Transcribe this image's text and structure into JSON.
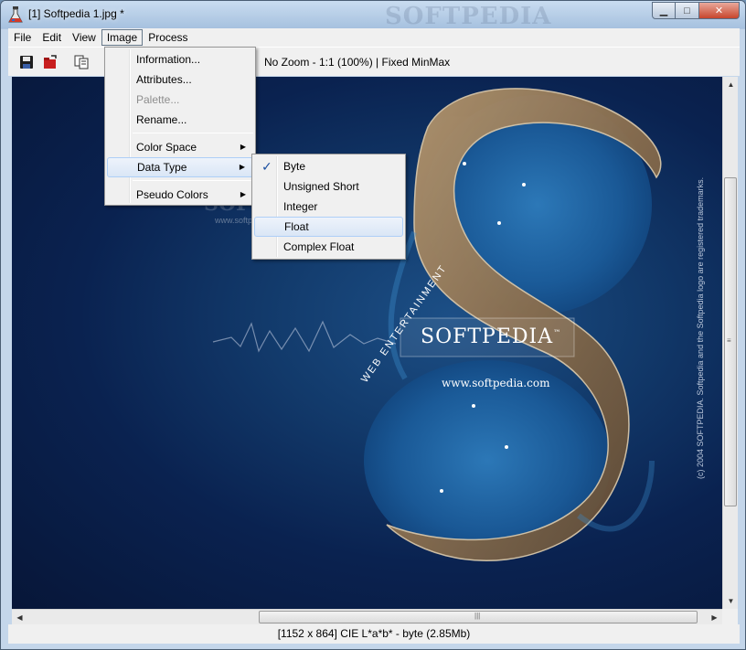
{
  "window": {
    "title": "[1] Softpedia 1.jpg *",
    "title_watermark": "SOFTPEDIA",
    "minimize": "▁",
    "maximize": "□",
    "close": "✕"
  },
  "menubar": [
    "File",
    "Edit",
    "View",
    "Image",
    "Process"
  ],
  "toolbar": {
    "icons": [
      "save-icon",
      "open-icon",
      "copy-icon"
    ],
    "zoom_info": "No Zoom - 1:1 (100%) | Fixed MinMax"
  },
  "image_menu": {
    "items": [
      {
        "label": "Information...",
        "enabled": true
      },
      {
        "label": "Attributes...",
        "enabled": true
      },
      {
        "label": "Palette...",
        "enabled": false
      },
      {
        "label": "Rename...",
        "enabled": true
      },
      {
        "label": "Color Space",
        "submenu": true
      },
      {
        "label": "Data Type",
        "submenu": true,
        "highlighted": true
      },
      {
        "label": "Pseudo Colors",
        "submenu": true
      }
    ]
  },
  "data_type_menu": {
    "items": [
      {
        "label": "Byte",
        "checked": true
      },
      {
        "label": "Unsigned Short",
        "checked": false
      },
      {
        "label": "Integer",
        "checked": false
      },
      {
        "label": "Float",
        "checked": false,
        "highlighted": true
      },
      {
        "label": "Complex Float",
        "checked": false
      }
    ]
  },
  "image": {
    "brand": "SOFTPEDIA",
    "brand_tm": "™",
    "url": "www.softpedia.com",
    "tagline": "WEB ENTERTAINMENT",
    "copyright": "(c) 2004 SOFTPEDIA. Softpedia and the Softpedia logo are registered trademarks.",
    "watermark": "SOFTPEDIA",
    "watermark_url": "www.softpedia.com"
  },
  "statusbar": "[1152 x 864] CIE L*a*b* - byte (2.85Mb)"
}
